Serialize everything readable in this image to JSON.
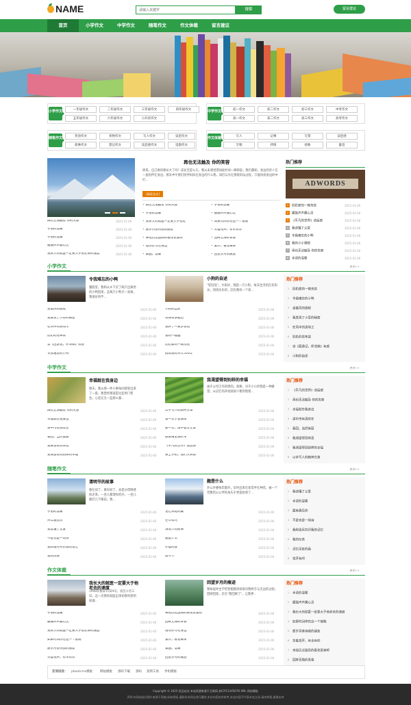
{
  "brand": {
    "name": "NAME"
  },
  "search": {
    "placeholder": "请输入关键字",
    "button": "搜索"
  },
  "header": {
    "message_btn": "留言建议"
  },
  "nav": [
    "首页",
    "小学作文",
    "中学作文",
    "随笔作文",
    "作文体裁",
    "留言建议"
  ],
  "cats": {
    "primary": {
      "tag": "小学作文",
      "items": [
        "一年级作文",
        "二年级作文",
        "三年级作文",
        "四年级作文",
        "五年级作文",
        "六年级作文",
        "小升初作文"
      ]
    },
    "middle": {
      "tag": "中学作文",
      "items": [
        "初一作文",
        "初二作文",
        "初三作文",
        "中考作文",
        "高一作文",
        "高二作文",
        "高三作文",
        "高考作文"
      ]
    },
    "essay": {
      "tag": "随笔作文",
      "items": [
        "英语作文",
        "状物作文",
        "写人作文",
        "读后作文",
        "叙事作文",
        "游记作文",
        "读后感作文",
        "话题作文"
      ]
    },
    "genre": {
      "tag": "作文体裁",
      "items": [
        "写人",
        "记事",
        "写景",
        "读后感",
        "写物",
        "抒情",
        "想象",
        "童话"
      ]
    }
  },
  "featured": {
    "title": "再也无法触及 你的笑容",
    "desc": "原来，自己真的要长大了吗？成长至是么久，我从未感觉得如此时间一瞬即逝，我们都知，身边的亲人在一直陪伴在身边，那天中午我们陪伴妈妈在身边的什么我，如仍与许在那接的坛过程，只能再找身边的中们…",
    "detail": "[阅读全文]"
  },
  "slide_list": [
    {
      "t": "再也无法触及 你的笑容",
      "d": "2025-01-06"
    },
    {
      "t": "手语的温暖",
      "d": "2025-01-06"
    },
    {
      "t": "手语的温暖",
      "d": "2025-01-06"
    },
    {
      "t": "腰鼓声声震心灵",
      "d": "2025-01-06"
    },
    {
      "t": "我长大的就医一定要大于他老去的速度",
      "d": "2025-01-06"
    }
  ],
  "mid_list": [
    "再也无法触及 你的笑容",
    "手语的温暖",
    "手语的温暖",
    "腰鼓声声震心灵",
    "我长大的就医一定要大于他老",
    "如果时间停在这一个夜晚",
    "愿岁月善待我的朋友",
    "笑着花开，有幸有你",
    "未经历过困局的看花更美吧",
    "回眸无悔的青春",
    "陪你抄写在身边",
    "紫外，看花来朵",
    "紫园，温暖",
    "回望岁月的痕迹"
  ],
  "hot_top": {
    "title": "热门推荐",
    "img_text": "ADWORDS",
    "items": [
      {
        "n": "1",
        "t": "奶奶家的一株荒花",
        "d": "2025-01-06"
      },
      {
        "t": "腰鼓声声震心灵",
        "n": "2",
        "d": "2025-01-06"
      },
      {
        "n": "3",
        "t": "《平凡的世界》读后感",
        "d": "2025-01-06"
      },
      {
        "n": "4",
        "t": "我读懂了父爱",
        "d": "2025-01-06"
      },
      {
        "n": "5",
        "t": "令我难忘的小鸭",
        "d": "2025-01-06"
      },
      {
        "n": "6",
        "t": "我的小小理想",
        "d": "2025-01-06"
      },
      {
        "n": "7",
        "t": "再也无法触及 你的笑容",
        "d": "2025-01-06"
      },
      {
        "n": "8",
        "t": "手语的温暖",
        "d": "2025-01-06"
      }
    ]
  },
  "more": "更多>>",
  "sections": [
    {
      "title": "小学作文",
      "a": {
        "h": "令我难忘的小鸭",
        "p": "暑假里，我和从乡下买了两只出黄色的小鸭回来，这两只小鸭子一身黄，我很好奇不…"
      },
      "b": {
        "h": "小狗的自述",
        "p": "\"旺旺旺\"，大家好，我是一只小狗，每天生活的在有阳光，快快乐乐的，因为我有一个家…"
      },
      "la": [
        "坐着风的旅程",
        "我发现了小草的秘密",
        "在风中的清场工",
        "奶奶的花布袋",
        "读《西游记，杯湾梯》有感",
        "令我难忘的小鸭"
      ],
      "lb": [
        "小狗的自述",
        "地球有多疑范",
        "我开了一家梦想馆",
        "我的一幅画",
        "奶奶家的一株荒花",
        "假如我有伟大500年"
      ],
      "hot": [
        "奶奶家的一株荒花",
        "令我难忘的小鸭",
        "坐着风的旅程",
        "我发现了小草的秘密",
        "在风中的清场工",
        "奶奶的花布袋",
        "读《西游记，杯湾梯》有感",
        "小狗的自述"
      ]
    },
    {
      "title": "中学作文",
      "a": {
        "h": "幸福就在我身边",
        "p": "那天，我从那一件小事每间感受出来了一套，我曾经那就是比亚用门帮生，心里又无一些那么都…"
      },
      "b": {
        "h": "我渴望得到别样的幸福",
        "p": "由于父母工作的原因，就要，对于小小的我是一种奢望，从记忆的开始就很少看到爸爸…"
      },
      "la": [
        "再也无法触及 你的笑容",
        "幸福就在我身边",
        "讲中市有清欢在",
        "春回，当然美丽",
        "我要望得到休息",
        "我渴望得到别样的幸福"
      ],
      "lb": [
        "以字写人的精神文章",
        "第一次学会骑车",
        "那一次，雨中春文文章",
        "取那薄主感听令",
        "《平凡的世界》读后感",
        "关上手机，我们大目前"
      ],
      "hot": [
        "《平凡的世界》读后感",
        "再也无法触及 你的笑容",
        "幸福就在我身边",
        "讲中市有清欢在",
        "春回，当然美丽",
        "我渴望得到休息",
        "我渴望得到别样的幸福",
        "以字写人的精神文章"
      ]
    },
    {
      "title": "随笔作文",
      "a": {
        "h": "清明节的故事",
        "p": "春在如了，春日如了，会是分得情感抵走来，一坐儿都理你的开，一坐儿都打几下眼前，我…"
      },
      "b": {
        "h": "题是什么",
        "p": "外公外婆每年都开，早时出来在家常手在种花，被一个完整后公公伴的身先于更是始到了…"
      },
      "la": [
        "手语的温暖",
        "开年遇见你",
        "我读懂了父爱",
        "不是也是一场诗",
        "我和张月共识我的记忆",
        "我的仪表"
      ],
      "lb": [
        "记忆深处的最",
        "芒市有时",
        "清明节的故事",
        "题是什么",
        "怀着的春",
        "偶今节"
      ],
      "hot": [
        "我读懂了父爱",
        "手语的温暖",
        "最美遇见你",
        "不是也是一场诗",
        "我和张月共识我的记忆",
        "我的仪表",
        "记忆深处的画",
        "花开有时"
      ]
    },
    {
      "title": "作文体裁",
      "a": {
        "h": "我长大的就医一定要大于他老去的速度",
        "p": "1998年我日11日9号，农历十月三日，这一天我的就医出来初春的感到很满…"
      },
      "b": {
        "h": "回望岁月的痕迹",
        "p": "我每届举主学控智能都话样很对我终于与无边的过程，回顾回来，走在\"我回顾了\"，让我更…"
      },
      "la": [
        "手语的温暖",
        "腰鼓声声震心灵",
        "我长大的就医一定要大于他老去的速度",
        "如果时间停在这一个夜晚",
        "愿岁月善待我的朋友",
        "笑着花开，有幸有你"
      ],
      "lb": [
        "未经历过困局的看花更美吧",
        "回眸无悔的青春",
        "陪你抄写在身边",
        "紫外，看花来朵",
        "紫园，温暖",
        "回望岁月的痕迹"
      ],
      "hot": [
        "手语的温暖",
        "腰鼓声声震心灵",
        "我长大的就医一定要大于他老去的速度",
        "如果时间停在这一个夜晚",
        "愿岁月善待我的朋友",
        "笑着花开，有幸有你",
        "未经历过困局的看花更美吧",
        "回眸无悔的青春"
      ]
    }
  ],
  "date": "2025-01-06",
  "friend_links": {
    "label": "友情链接：",
    "items": [
      "pbootcms模板",
      "网站模板",
      "源码下载",
      "源码",
      "案例工具",
      "手机模板"
    ]
  },
  "footer": {
    "line1": "Copyright © 2025 优品站点 本站资源来源于互联网  苏ICP12345678  XML  网站模板",
    "line2": "声明:本网站部分图片来源于网络,如有侵权,请联系本网站进行删除,本站内容仅供参考,本站内容不代表本站立场,请勿转载,谢谢支持"
  }
}
